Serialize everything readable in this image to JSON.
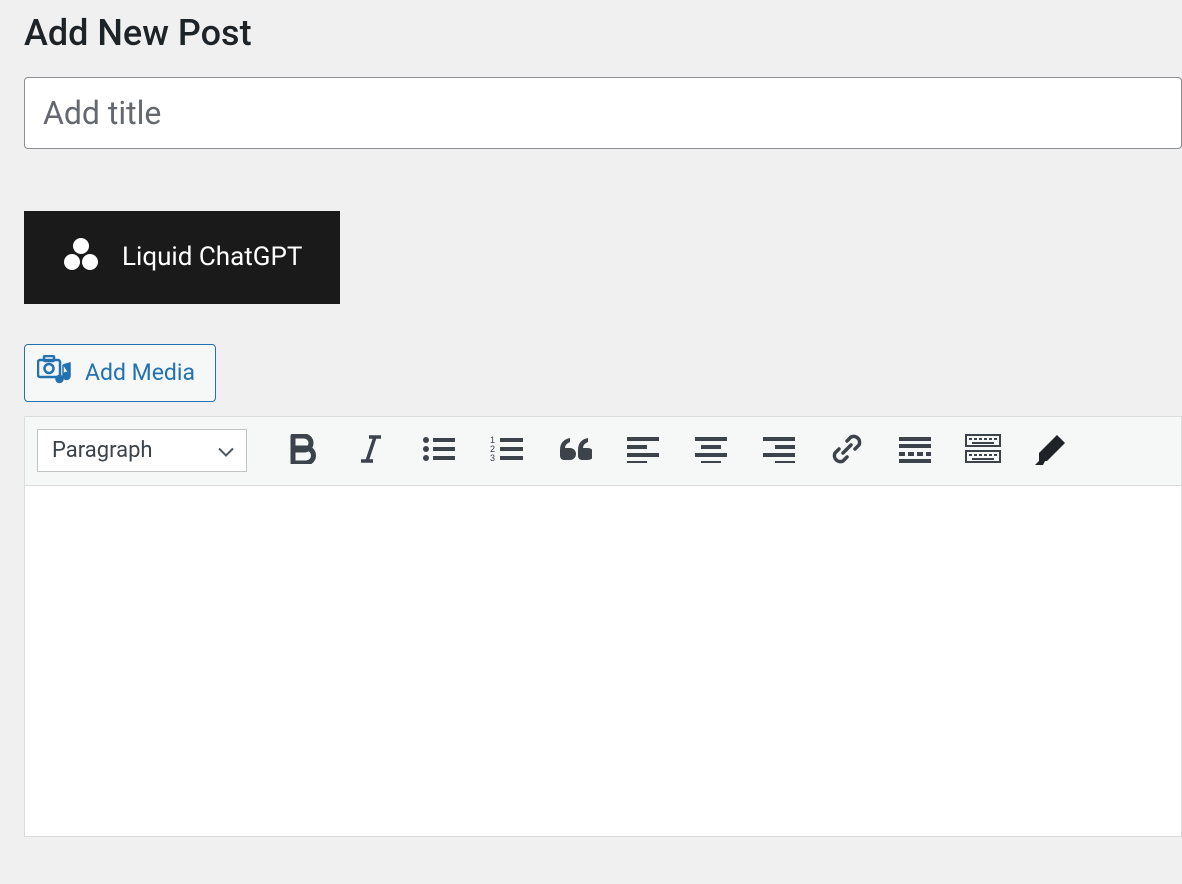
{
  "page": {
    "title": "Add New Post"
  },
  "title_input": {
    "placeholder": "Add title",
    "value": ""
  },
  "liquid_button": {
    "label": "Liquid ChatGPT"
  },
  "add_media": {
    "label": "Add Media"
  },
  "toolbar": {
    "format_select": "Paragraph"
  }
}
